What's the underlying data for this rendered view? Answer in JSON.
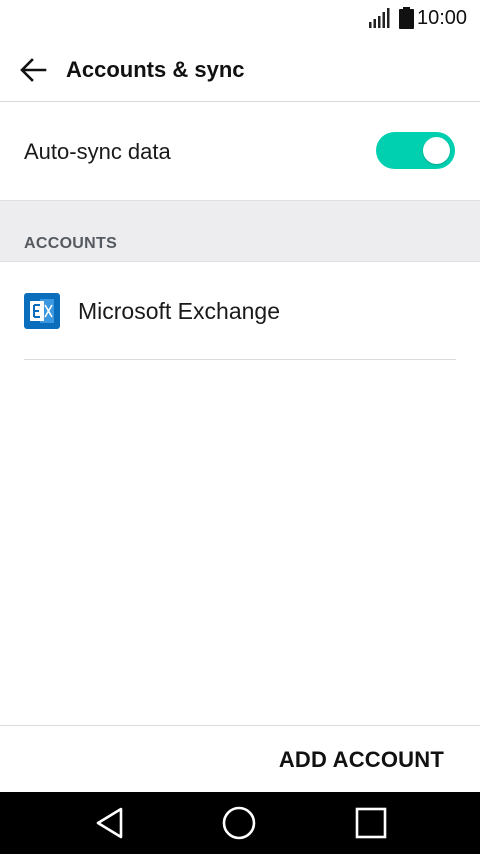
{
  "status_bar": {
    "time": "10:00",
    "signal_icon": "signal-bars-icon",
    "battery_icon": "battery-icon"
  },
  "app_bar": {
    "back_icon": "arrow-left-icon",
    "title": "Accounts & sync"
  },
  "auto_sync": {
    "label": "Auto-sync data",
    "enabled": true,
    "accent_color": "#00d0b0"
  },
  "accounts_section": {
    "header": "ACCOUNTS",
    "items": [
      {
        "name": "Microsoft Exchange",
        "icon": "microsoft-exchange-icon",
        "icon_color": "#0a6ebd"
      }
    ]
  },
  "footer": {
    "add_account_label": "ADD ACCOUNT"
  },
  "nav_bar": {
    "back_icon": "triangle-back-icon",
    "home_icon": "circle-home-icon",
    "recents_icon": "square-recents-icon"
  }
}
